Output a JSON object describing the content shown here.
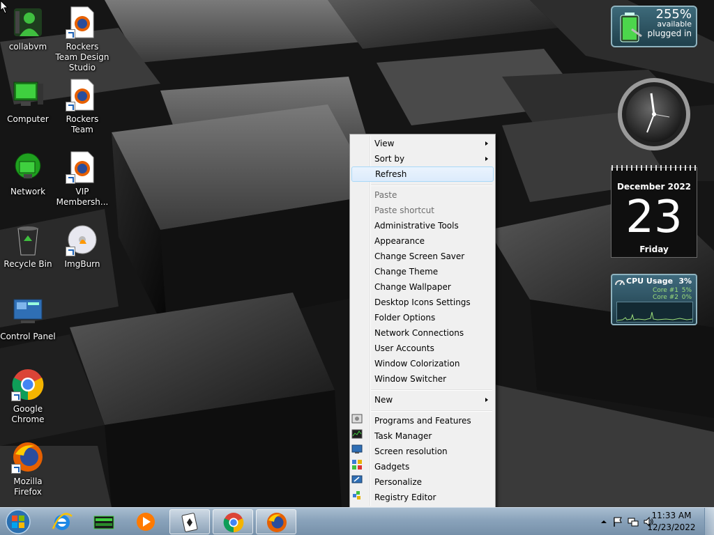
{
  "desktop": {
    "icons": [
      {
        "label": "collabvm",
        "icon": "user-icon"
      },
      {
        "label": "Rockers Team Design Studio",
        "icon": "firefox-document-icon"
      },
      {
        "label": "Computer",
        "icon": "computer-icon"
      },
      {
        "label": "Rockers Team",
        "icon": "firefox-document-icon"
      },
      {
        "label": "Network",
        "icon": "network-icon"
      },
      {
        "label": "VIP Membersh...",
        "icon": "firefox-document-icon"
      },
      {
        "label": "Recycle Bin",
        "icon": "recycle-bin-icon"
      },
      {
        "label": "ImgBurn",
        "icon": "disc-icon"
      },
      {
        "label": "Control Panel",
        "icon": "control-panel-icon"
      },
      {
        "label": "Google Chrome",
        "icon": "chrome-icon"
      },
      {
        "label": "Mozilla Firefox",
        "icon": "firefox-icon"
      }
    ]
  },
  "gadgets": {
    "battery": {
      "percent": "255%",
      "status1": "available",
      "status2": "plugged in"
    },
    "calendar": {
      "month": "December 2022",
      "day": "23",
      "weekday": "Friday"
    },
    "cpu": {
      "title": "CPU Usage",
      "total": "3%",
      "core1_label": "Core #1",
      "core1_value": "5%",
      "core2_label": "Core #2",
      "core2_value": "0%"
    }
  },
  "context_menu": {
    "items": [
      {
        "label": "View",
        "submenu": true
      },
      {
        "label": "Sort by",
        "submenu": true
      },
      {
        "label": "Refresh",
        "highlighted": true
      },
      {
        "label": "Paste",
        "disabled": true
      },
      {
        "label": "Paste shortcut",
        "disabled": true
      },
      {
        "label": "Administrative Tools"
      },
      {
        "label": "Appearance"
      },
      {
        "label": "Change Screen Saver"
      },
      {
        "label": "Change Theme"
      },
      {
        "label": "Change Wallpaper"
      },
      {
        "label": "Desktop Icons Settings"
      },
      {
        "label": "Folder Options"
      },
      {
        "label": "Network Connections"
      },
      {
        "label": "User Accounts"
      },
      {
        "label": "Window Colorization"
      },
      {
        "label": "Window Switcher"
      },
      {
        "label": "New",
        "submenu": true
      },
      {
        "label": "Programs and Features",
        "icon": "programs-features-icon"
      },
      {
        "label": "Task Manager",
        "icon": "task-manager-icon"
      },
      {
        "label": "Screen resolution",
        "icon": "screen-resolution-icon"
      },
      {
        "label": "Gadgets",
        "icon": "gadgets-icon"
      },
      {
        "label": "Personalize",
        "icon": "personalize-icon"
      },
      {
        "label": "Registry Editor",
        "icon": "registry-editor-icon"
      }
    ]
  },
  "taskbar": {
    "pinned": [
      {
        "name": "internet-explorer",
        "icon": "ie-icon"
      },
      {
        "name": "windows-explorer",
        "icon": "explorer-icon"
      },
      {
        "name": "media-player",
        "icon": "media-player-icon"
      },
      {
        "name": "solitaire",
        "icon": "solitaire-icon",
        "active": true
      },
      {
        "name": "google-chrome",
        "icon": "chrome-icon",
        "active": true
      },
      {
        "name": "firefox",
        "icon": "firefox-icon",
        "active": true
      }
    ],
    "clock": {
      "time": "11:33 AM",
      "date": "12/23/2022"
    }
  },
  "colors": {
    "menu_bg": "#f0f0f0",
    "menu_highlight": "#dcebfc",
    "taskbar": "#8aa3bb"
  }
}
